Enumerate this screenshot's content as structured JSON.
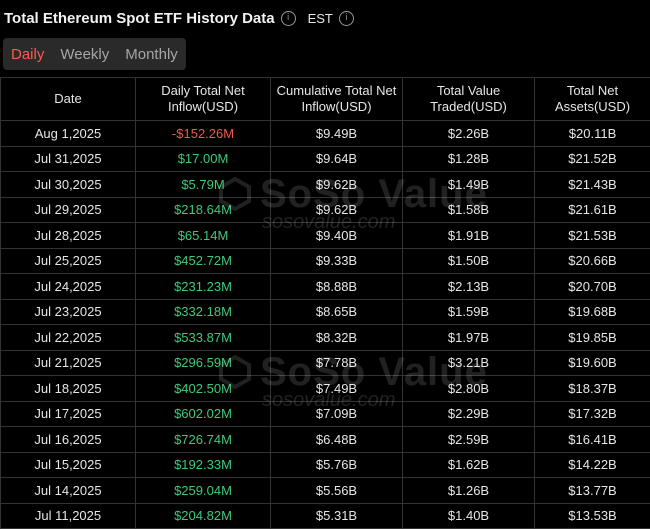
{
  "header": {
    "title": "Total Ethereum Spot ETF History Data",
    "timezone": "EST"
  },
  "icons": {
    "info": "info-circle-icon"
  },
  "tabs": [
    {
      "label": "Daily",
      "active": true
    },
    {
      "label": "Weekly",
      "active": false
    },
    {
      "label": "Monthly",
      "active": false
    }
  ],
  "columns": {
    "date": "Date",
    "net_inflow": "Daily Total Net Inflow(USD)",
    "cumulative": "Cumulative Total Net Inflow(USD)",
    "traded": "Total Value Traded(USD)",
    "assets": "Total Net Assets(USD)"
  },
  "rows": [
    {
      "date": "Aug 1,2025",
      "net_inflow": "-$152.26M",
      "sign": "neg",
      "cumulative": "$9.49B",
      "traded": "$2.26B",
      "assets": "$20.11B"
    },
    {
      "date": "Jul 31,2025",
      "net_inflow": "$17.00M",
      "sign": "pos",
      "cumulative": "$9.64B",
      "traded": "$1.28B",
      "assets": "$21.52B"
    },
    {
      "date": "Jul 30,2025",
      "net_inflow": "$5.79M",
      "sign": "pos",
      "cumulative": "$9.62B",
      "traded": "$1.49B",
      "assets": "$21.43B"
    },
    {
      "date": "Jul 29,2025",
      "net_inflow": "$218.64M",
      "sign": "pos",
      "cumulative": "$9.62B",
      "traded": "$1.58B",
      "assets": "$21.61B"
    },
    {
      "date": "Jul 28,2025",
      "net_inflow": "$65.14M",
      "sign": "pos",
      "cumulative": "$9.40B",
      "traded": "$1.91B",
      "assets": "$21.53B"
    },
    {
      "date": "Jul 25,2025",
      "net_inflow": "$452.72M",
      "sign": "pos",
      "cumulative": "$9.33B",
      "traded": "$1.50B",
      "assets": "$20.66B"
    },
    {
      "date": "Jul 24,2025",
      "net_inflow": "$231.23M",
      "sign": "pos",
      "cumulative": "$8.88B",
      "traded": "$2.13B",
      "assets": "$20.70B"
    },
    {
      "date": "Jul 23,2025",
      "net_inflow": "$332.18M",
      "sign": "pos",
      "cumulative": "$8.65B",
      "traded": "$1.59B",
      "assets": "$19.68B"
    },
    {
      "date": "Jul 22,2025",
      "net_inflow": "$533.87M",
      "sign": "pos",
      "cumulative": "$8.32B",
      "traded": "$1.97B",
      "assets": "$19.85B"
    },
    {
      "date": "Jul 21,2025",
      "net_inflow": "$296.59M",
      "sign": "pos",
      "cumulative": "$7.78B",
      "traded": "$3.21B",
      "assets": "$19.60B"
    },
    {
      "date": "Jul 18,2025",
      "net_inflow": "$402.50M",
      "sign": "pos",
      "cumulative": "$7.49B",
      "traded": "$2.80B",
      "assets": "$18.37B"
    },
    {
      "date": "Jul 17,2025",
      "net_inflow": "$602.02M",
      "sign": "pos",
      "cumulative": "$7.09B",
      "traded": "$2.29B",
      "assets": "$17.32B"
    },
    {
      "date": "Jul 16,2025",
      "net_inflow": "$726.74M",
      "sign": "pos",
      "cumulative": "$6.48B",
      "traded": "$2.59B",
      "assets": "$16.41B"
    },
    {
      "date": "Jul 15,2025",
      "net_inflow": "$192.33M",
      "sign": "pos",
      "cumulative": "$5.76B",
      "traded": "$1.62B",
      "assets": "$14.22B"
    },
    {
      "date": "Jul 14,2025",
      "net_inflow": "$259.04M",
      "sign": "pos",
      "cumulative": "$5.56B",
      "traded": "$1.26B",
      "assets": "$13.77B"
    },
    {
      "date": "Jul 11,2025",
      "net_inflow": "$204.82M",
      "sign": "pos",
      "cumulative": "$5.31B",
      "traded": "$1.40B",
      "assets": "$13.53B"
    }
  ],
  "watermark": {
    "logo": "SoSo Value",
    "url": "sosovalue.com"
  },
  "colors": {
    "positive": "#3ec97a",
    "negative": "#ef5a4e",
    "active_tab": "#ff5a4e"
  }
}
